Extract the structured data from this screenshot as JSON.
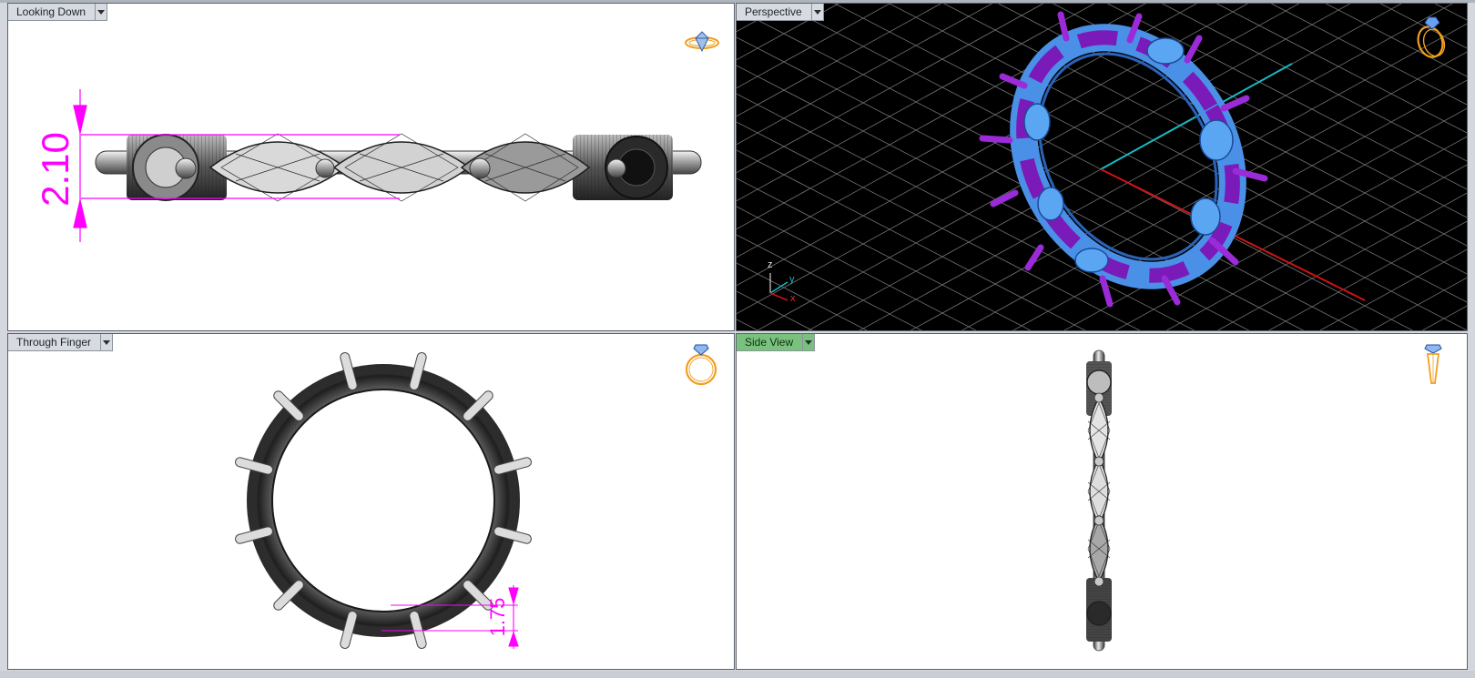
{
  "viewports": {
    "top_left": {
      "label": "Looking Down",
      "icon": "ring-top-view-icon",
      "dimension": "2.10"
    },
    "top_right": {
      "label": "Perspective",
      "icon": "ring-perspective-icon",
      "axes": {
        "z": "z",
        "y": "y",
        "x": "x"
      }
    },
    "bottom_left": {
      "label": "Through Finger",
      "icon": "ring-front-view-icon",
      "dimension": "1.75"
    },
    "bottom_right": {
      "label": "Side View",
      "icon": "ring-side-view-icon",
      "active": true
    }
  },
  "colors": {
    "dimension": "#ff00ff",
    "active_tab": "#79c27d",
    "metal_purple": "#8a1fc4",
    "gem_blue": "#4a90e6",
    "axis_red": "#d01212",
    "axis_cyan": "#19b9c2",
    "nav_icon": "#f0a020"
  }
}
